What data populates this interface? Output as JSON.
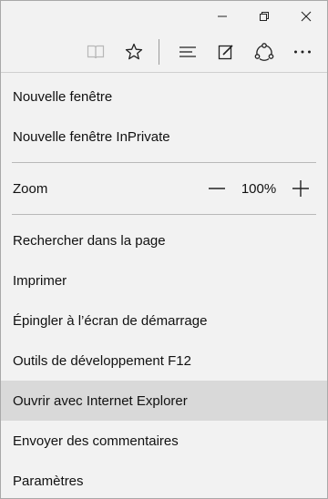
{
  "titlebar": {
    "minimize_icon": "minimize-icon",
    "restore_icon": "restore-icon",
    "close_icon": "close-icon"
  },
  "toolbar": {
    "icons": [
      "reading-view-icon",
      "favorites-star-icon",
      "hub-icon",
      "web-note-icon",
      "share-icon",
      "more-actions-icon"
    ]
  },
  "menu": {
    "new_window": "Nouvelle fenêtre",
    "new_inprivate": "Nouvelle fenêtre InPrivate",
    "zoom_label": "Zoom",
    "zoom_value": "100%",
    "find_in_page": "Rechercher dans la page",
    "print": "Imprimer",
    "pin_to_start": "Épingler à l’écran de démarrage",
    "dev_tools": "Outils de développement F12",
    "open_ie": "Ouvrir avec Internet Explorer",
    "send_feedback": "Envoyer des commentaires",
    "settings": "Paramètres"
  },
  "colors": {
    "background": "#f2f2f2",
    "hover": "#d9d9d9",
    "separator": "#b9b9b9",
    "text": "#111111"
  }
}
